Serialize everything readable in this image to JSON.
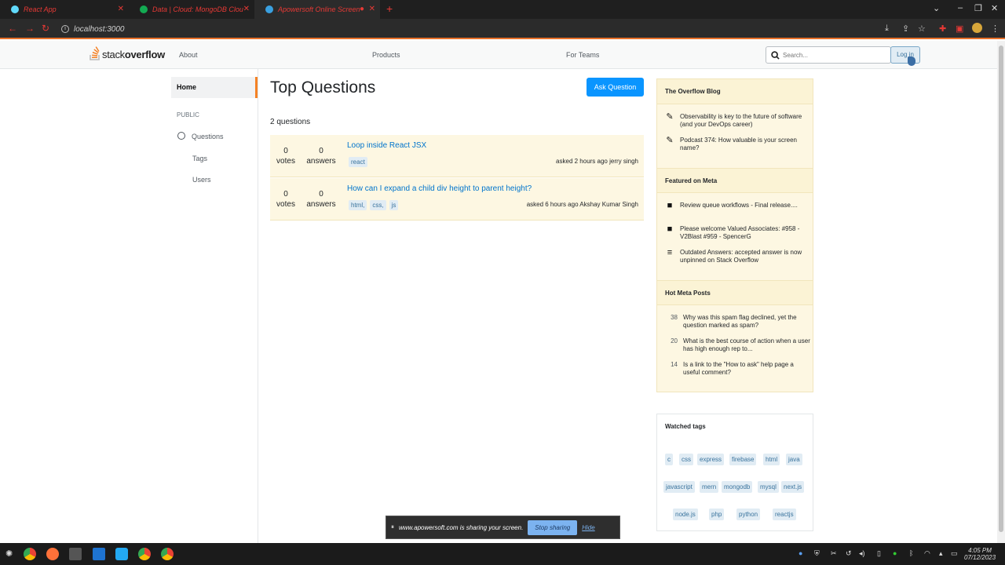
{
  "browser": {
    "tabs": [
      {
        "title": "React App"
      },
      {
        "title": "Data | Cloud: MongoDB Clou"
      },
      {
        "title": "Apowersoft Online Screen"
      }
    ],
    "url": "localhost:3000"
  },
  "header": {
    "logo_light": "stack",
    "logo_bold": "overflow",
    "links": [
      "About",
      "Products",
      "For Teams"
    ],
    "search_placeholder": "Search...",
    "login_label": "Log in"
  },
  "sidebar": {
    "home": "Home",
    "public": "PUBLIC",
    "items": [
      "Questions",
      "Tags",
      "Users"
    ]
  },
  "main": {
    "title": "Top Questions",
    "ask_button": "Ask Question",
    "count": "2 questions",
    "questions": [
      {
        "votes": "0",
        "votes_label": "votes",
        "answers": "0",
        "answers_label": "answers",
        "title": "Loop inside React JSX",
        "tags": [
          "react"
        ],
        "asked": "asked 2 hours ago jerry singh"
      },
      {
        "votes": "0",
        "votes_label": "votes",
        "answers": "0",
        "answers_label": "answers",
        "title": "How can I expand a child div height to parent height?",
        "tags": [
          "html,",
          "css,",
          "js"
        ],
        "asked": "asked 6 hours ago Akshay Kumar Singh"
      }
    ]
  },
  "widget": {
    "blog_header": "The Overflow Blog",
    "blog_items": [
      {
        "text": "Observability is key to the future of software (and your DevOps career)",
        "icon": "pencil-icon"
      },
      {
        "text": "Podcast 374: How valuable is your screen name?",
        "icon": "pencil-icon"
      }
    ],
    "meta_header": "Featured on Meta",
    "meta_items": [
      {
        "text": "Review queue workflows - Final release....",
        "icon": "comment-icon"
      },
      {
        "text": "Please welcome Valued Associates: #958 - V2Blast #959 - SpencerG",
        "icon": "comment-icon"
      },
      {
        "text": "Outdated Answers: accepted answer is now unpinned on Stack Overflow",
        "icon": "stackoverflow-icon"
      }
    ],
    "hot_header": "Hot Meta Posts",
    "hot_items": [
      {
        "num": "38",
        "text": "Why was this spam flag declined, yet the question marked as spam?"
      },
      {
        "num": "20",
        "text": "What is the best course of action when a user has high enough rep to..."
      },
      {
        "num": "14",
        "text": "Is a link to the \"How to ask\" help page a useful comment?"
      }
    ]
  },
  "watched": {
    "header": "Watched tags",
    "tags": [
      "c",
      "css",
      "express",
      "firebase",
      "html",
      "java",
      "javascript",
      "mern",
      "mongodb",
      "mysql",
      "next.js",
      "node.js",
      "php",
      "python",
      "reactjs"
    ]
  },
  "sharebar": {
    "message": "www.apowersoft.com is sharing your screen.",
    "stop": "Stop sharing",
    "hide": "Hide"
  },
  "taskbar": {
    "time": "4:05 PM",
    "date": "07/12/2023"
  },
  "colors": {
    "accent": "#f48225",
    "link": "#0074cc",
    "button": "#0a95ff",
    "highlight": "#fdf7e2"
  }
}
